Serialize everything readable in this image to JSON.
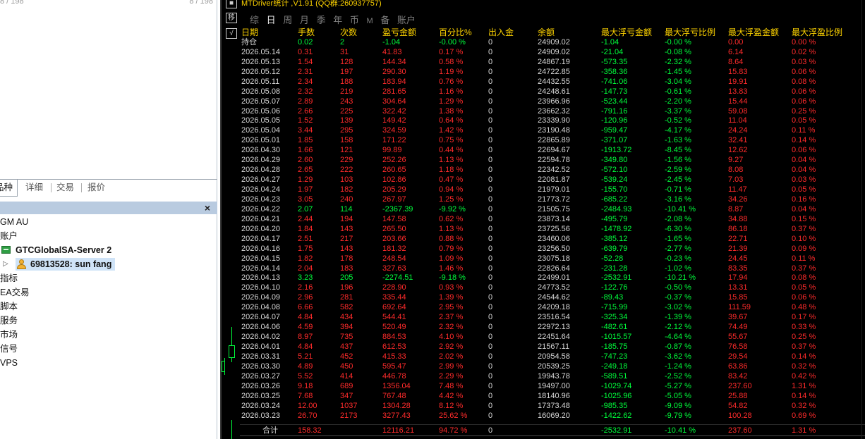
{
  "left_panel": {
    "top_count_left": "8 / 198",
    "top_count_right": "8 / 198",
    "tabs": [
      {
        "label": "品种",
        "active": true
      },
      {
        "label": "详细",
        "active": false
      },
      {
        "label": "交易",
        "active": false
      },
      {
        "label": "报价",
        "active": false
      }
    ],
    "navigator_items": {
      "broker": "GM AU",
      "accounts": "账户",
      "server": "GTCGlobalSA-Server 2",
      "account": "69813528: sun fang",
      "indicators": "指标",
      "ea": "EA交易",
      "scripts": "脚本",
      "services": "服务",
      "market": "市场",
      "signals": "信号",
      "vps": "VPS"
    },
    "close_label": "×"
  },
  "chart": {
    "title": "MTDriver统计 ,V1.91 (QQ群:260937757)",
    "side_buttons": [
      "移",
      "√"
    ],
    "toolbar": [
      {
        "label": "综",
        "active": false
      },
      {
        "label": "日",
        "active": true
      },
      {
        "label": "周",
        "active": false
      },
      {
        "label": "月",
        "active": false
      },
      {
        "label": "季",
        "active": false
      },
      {
        "label": "年",
        "active": false
      },
      {
        "label": "币",
        "active": false
      },
      {
        "label": "M",
        "active": false
      },
      {
        "label": "备",
        "active": false
      },
      {
        "label": "账户",
        "active": false
      }
    ],
    "headers": [
      "日期",
      "手数",
      "次数",
      "盈亏金额",
      "百分比%",
      "出入金",
      "余额",
      "最大浮亏金额",
      "最大浮亏比例",
      "最大浮盈金额",
      "最大浮盈比例"
    ],
    "rows": [
      [
        "持仓",
        "0.02",
        "2",
        "-1.04",
        "-0.00 %",
        "0",
        "24909.02",
        "-1.04",
        "-0.00 %",
        "0.00",
        "0.00 %"
      ],
      [
        "2026.05.14",
        "0.31",
        "31",
        "41.83",
        "0.17 %",
        "0",
        "24909.02",
        "-21.04",
        "-0.08 %",
        "6.14",
        "0.02 %"
      ],
      [
        "2026.05.13",
        "1.54",
        "128",
        "144.34",
        "0.58 %",
        "0",
        "24867.19",
        "-573.35",
        "-2.32 %",
        "8.64",
        "0.03 %"
      ],
      [
        "2026.05.12",
        "2.31",
        "197",
        "290.30",
        "1.19 %",
        "0",
        "24722.85",
        "-358.36",
        "-1.45 %",
        "15.83",
        "0.06 %"
      ],
      [
        "2026.05.11",
        "2.34",
        "188",
        "183.94",
        "0.76 %",
        "0",
        "24432.55",
        "-741.06",
        "-3.04 %",
        "19.91",
        "0.08 %"
      ],
      [
        "2026.05.08",
        "2.32",
        "219",
        "281.65",
        "1.16 %",
        "0",
        "24248.61",
        "-147.73",
        "-0.61 %",
        "13.83",
        "0.06 %"
      ],
      [
        "2026.05.07",
        "2.89",
        "243",
        "304.64",
        "1.29 %",
        "0",
        "23966.96",
        "-523.44",
        "-2.20 %",
        "15.44",
        "0.06 %"
      ],
      [
        "2026.05.06",
        "2.66",
        "225",
        "322.42",
        "1.38 %",
        "0",
        "23662.32",
        "-791.16",
        "-3.37 %",
        "59.08",
        "0.25 %"
      ],
      [
        "2026.05.05",
        "1.52",
        "139",
        "149.42",
        "0.64 %",
        "0",
        "23339.90",
        "-120.96",
        "-0.52 %",
        "11.04",
        "0.05 %"
      ],
      [
        "2026.05.04",
        "3.44",
        "295",
        "324.59",
        "1.42 %",
        "0",
        "23190.48",
        "-959.47",
        "-4.17 %",
        "24.24",
        "0.11 %"
      ],
      [
        "2026.05.01",
        "1.85",
        "158",
        "171.22",
        "0.75 %",
        "0",
        "22865.89",
        "-371.07",
        "-1.63 %",
        "32.41",
        "0.14 %"
      ],
      [
        "2026.04.30",
        "1.66",
        "121",
        "99.89",
        "0.44 %",
        "0",
        "22694.67",
        "-1913.72",
        "-8.45 %",
        "12.62",
        "0.06 %"
      ],
      [
        "2026.04.29",
        "2.60",
        "229",
        "252.26",
        "1.13 %",
        "0",
        "22594.78",
        "-349.80",
        "-1.56 %",
        "9.27",
        "0.04 %"
      ],
      [
        "2026.04.28",
        "2.65",
        "222",
        "260.65",
        "1.18 %",
        "0",
        "22342.52",
        "-572.10",
        "-2.59 %",
        "8.08",
        "0.04 %"
      ],
      [
        "2026.04.27",
        "1.29",
        "103",
        "102.86",
        "0.47 %",
        "0",
        "22081.87",
        "-539.24",
        "-2.45 %",
        "7.03",
        "0.03 %"
      ],
      [
        "2026.04.24",
        "1.97",
        "182",
        "205.29",
        "0.94 %",
        "0",
        "21979.01",
        "-155.70",
        "-0.71 %",
        "11.47",
        "0.05 %"
      ],
      [
        "2026.04.23",
        "3.05",
        "240",
        "267.97",
        "1.25 %",
        "0",
        "21773.72",
        "-685.22",
        "-3.16 %",
        "34.26",
        "0.16 %"
      ],
      [
        "2026.04.22",
        "2.07",
        "114",
        "-2367.39",
        "-9.92 %",
        "0",
        "21505.75",
        "-2484.93",
        "-10.41 %",
        "8.87",
        "0.04 %"
      ],
      [
        "2026.04.21",
        "2.44",
        "194",
        "147.58",
        "0.62 %",
        "0",
        "23873.14",
        "-495.79",
        "-2.08 %",
        "34.88",
        "0.15 %"
      ],
      [
        "2026.04.20",
        "1.84",
        "143",
        "265.50",
        "1.13 %",
        "0",
        "23725.56",
        "-1478.92",
        "-6.30 %",
        "86.18",
        "0.37 %"
      ],
      [
        "2026.04.17",
        "2.51",
        "217",
        "203.66",
        "0.88 %",
        "0",
        "23460.06",
        "-385.12",
        "-1.65 %",
        "22.71",
        "0.10 %"
      ],
      [
        "2026.04.16",
        "1.75",
        "143",
        "181.32",
        "0.79 %",
        "0",
        "23256.50",
        "-639.79",
        "-2.77 %",
        "21.39",
        "0.09 %"
      ],
      [
        "2026.04.15",
        "1.82",
        "178",
        "248.54",
        "1.09 %",
        "0",
        "23075.18",
        "-52.28",
        "-0.23 %",
        "24.45",
        "0.11 %"
      ],
      [
        "2026.04.14",
        "2.04",
        "183",
        "327.63",
        "1.46 %",
        "0",
        "22826.64",
        "-231.28",
        "-1.02 %",
        "83.35",
        "0.37 %"
      ],
      [
        "2026.04.13",
        "3.23",
        "205",
        "-2274.51",
        "-9.18 %",
        "0",
        "22499.01",
        "-2532.91",
        "-10.21 %",
        "17.94",
        "0.08 %"
      ],
      [
        "2026.04.10",
        "2.16",
        "196",
        "228.90",
        "0.93 %",
        "0",
        "24773.52",
        "-122.76",
        "-0.50 %",
        "13.31",
        "0.05 %"
      ],
      [
        "2026.04.09",
        "2.96",
        "281",
        "335.44",
        "1.39 %",
        "0",
        "24544.62",
        "-89.43",
        "-0.37 %",
        "15.85",
        "0.06 %"
      ],
      [
        "2026.04.08",
        "6.66",
        "582",
        "692.64",
        "2.95 %",
        "0",
        "24209.18",
        "-715.99",
        "-3.02 %",
        "111.59",
        "0.48 %"
      ],
      [
        "2026.04.07",
        "4.84",
        "434",
        "544.41",
        "2.37 %",
        "0",
        "23516.54",
        "-325.34",
        "-1.39 %",
        "39.67",
        "0.17 %"
      ],
      [
        "2026.04.06",
        "4.59",
        "394",
        "520.49",
        "2.32 %",
        "0",
        "22972.13",
        "-482.61",
        "-2.12 %",
        "74.49",
        "0.33 %"
      ],
      [
        "2026.04.02",
        "8.97",
        "735",
        "884.53",
        "4.10 %",
        "0",
        "22451.64",
        "-1015.57",
        "-4.64 %",
        "55.67",
        "0.25 %"
      ],
      [
        "2026.04.01",
        "4.84",
        "437",
        "612.53",
        "2.92 %",
        "0",
        "21567.11",
        "-185.75",
        "-0.87 %",
        "76.58",
        "0.37 %"
      ],
      [
        "2026.03.31",
        "5.21",
        "452",
        "415.33",
        "2.02 %",
        "0",
        "20954.58",
        "-747.23",
        "-3.62 %",
        "29.54",
        "0.14 %"
      ],
      [
        "2026.03.30",
        "4.89",
        "450",
        "595.47",
        "2.99 %",
        "0",
        "20539.25",
        "-249.18",
        "-1.24 %",
        "63.86",
        "0.32 %"
      ],
      [
        "2026.03.27",
        "5.52",
        "414",
        "446.78",
        "2.29 %",
        "0",
        "19943.78",
        "-589.51",
        "-2.52 %",
        "83.42",
        "0.42 %"
      ],
      [
        "2026.03.26",
        "9.18",
        "689",
        "1356.04",
        "7.48 %",
        "0",
        "19497.00",
        "-1029.74",
        "-5.27 %",
        "237.60",
        "1.31 %"
      ],
      [
        "2026.03.25",
        "7.68",
        "347",
        "767.48",
        "4.42 %",
        "0",
        "18140.96",
        "-1025.96",
        "-5.05 %",
        "25.88",
        "0.14 %"
      ],
      [
        "2026.03.24",
        "12.00",
        "1037",
        "1304.28",
        "8.12 %",
        "0",
        "17373.48",
        "-985.35",
        "-9.09 %",
        "54.82",
        "0.32 %"
      ],
      [
        "2026.03.23",
        "26.70",
        "2173",
        "3277.43",
        "25.62 %",
        "0",
        "16069.20",
        "-1422.62",
        "-9.79 %",
        "100.28",
        "0.69 %"
      ]
    ],
    "total": {
      "label": "合计",
      "lots": "158.32",
      "pnl": "12116.21",
      "pct": "94.72 %",
      "deposit": "0",
      "max_float_loss": "-2532.91",
      "max_float_loss_pct": "-10.41 %",
      "max_float_profit": "237.60",
      "max_float_profit_pct": "1.31 %"
    },
    "colors": {
      "header": "#ffd400",
      "positive": "#ff2b2b",
      "negative": "#00ff3c",
      "neutral": "#d8d8d8"
    }
  }
}
